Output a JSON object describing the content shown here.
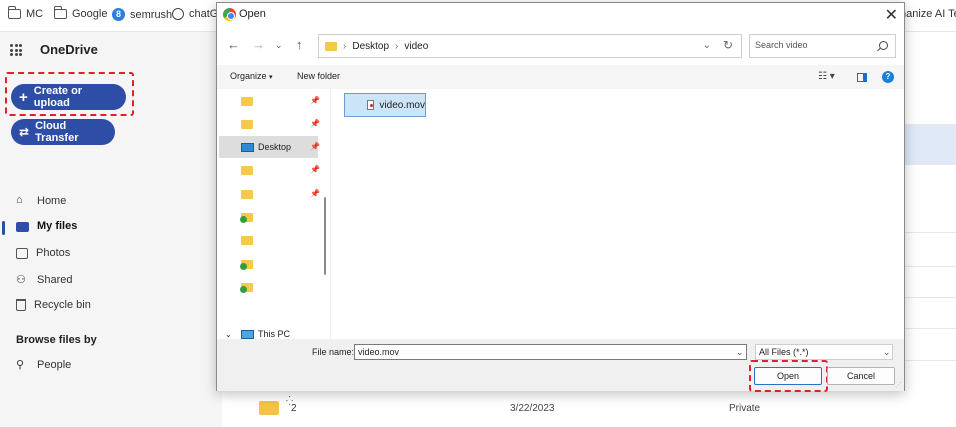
{
  "bookmarks": {
    "items": [
      {
        "label": "MC",
        "icon": "folder-icon"
      },
      {
        "label": "Google",
        "icon": "folder-icon"
      },
      {
        "label": "semrush",
        "icon": "semrush-icon"
      },
      {
        "label": "chatGP",
        "icon": "chatgpt-icon"
      }
    ],
    "overflow_label": "nanize AI Text"
  },
  "onedrive": {
    "brand": "OneDrive",
    "create_label": "Create or upload",
    "transfer_label": "Cloud Transfer",
    "nav": [
      {
        "label": "Home",
        "icon": "home-icon"
      },
      {
        "label": "My files",
        "icon": "folder-icon",
        "active": true
      },
      {
        "label": "Photos",
        "icon": "photo-icon"
      },
      {
        "label": "Shared",
        "icon": "shared-icon"
      },
      {
        "label": "Recycle bin",
        "icon": "recycle-bin-icon"
      }
    ],
    "browse_header": "Browse files by",
    "browse_nav": [
      {
        "label": "People",
        "icon": "person-icon"
      }
    ],
    "visible_row": {
      "name": "2",
      "date": "3/22/2023",
      "access": "Private"
    }
  },
  "dialog": {
    "title": "Open",
    "breadcrumb": [
      "Desktop",
      "video"
    ],
    "search_placeholder": "Search video",
    "organize_label": "Organize",
    "new_folder_label": "New folder",
    "tree": [
      {
        "label": "",
        "icon": "folder-icon",
        "pinned": true
      },
      {
        "label": "",
        "icon": "folder-icon",
        "pinned": true
      },
      {
        "label": "Desktop",
        "icon": "desktop-icon",
        "pinned": true,
        "selected": true
      },
      {
        "label": "",
        "icon": "folder-icon",
        "pinned": true
      },
      {
        "label": "",
        "icon": "folder-icon",
        "pinned": true
      },
      {
        "label": "",
        "icon": "folder-sync-icon",
        "pinned": false
      },
      {
        "label": "",
        "icon": "folder-icon",
        "pinned": false
      },
      {
        "label": "",
        "icon": "folder-sync-icon",
        "pinned": false
      },
      {
        "label": "",
        "icon": "folder-sync-icon",
        "pinned": false
      }
    ],
    "this_pc_label": "This PC",
    "files": [
      {
        "name": "video.mov",
        "icon": "video-file-icon",
        "selected": true
      }
    ],
    "file_name_label": "File name:",
    "file_name_value": "video.mov",
    "file_type": "All Files (*.*)",
    "open_label": "Open",
    "cancel_label": "Cancel"
  },
  "colors": {
    "accent": "#2e4da6",
    "highlight_box": "#e0202a",
    "selection": "#cce4f7"
  }
}
